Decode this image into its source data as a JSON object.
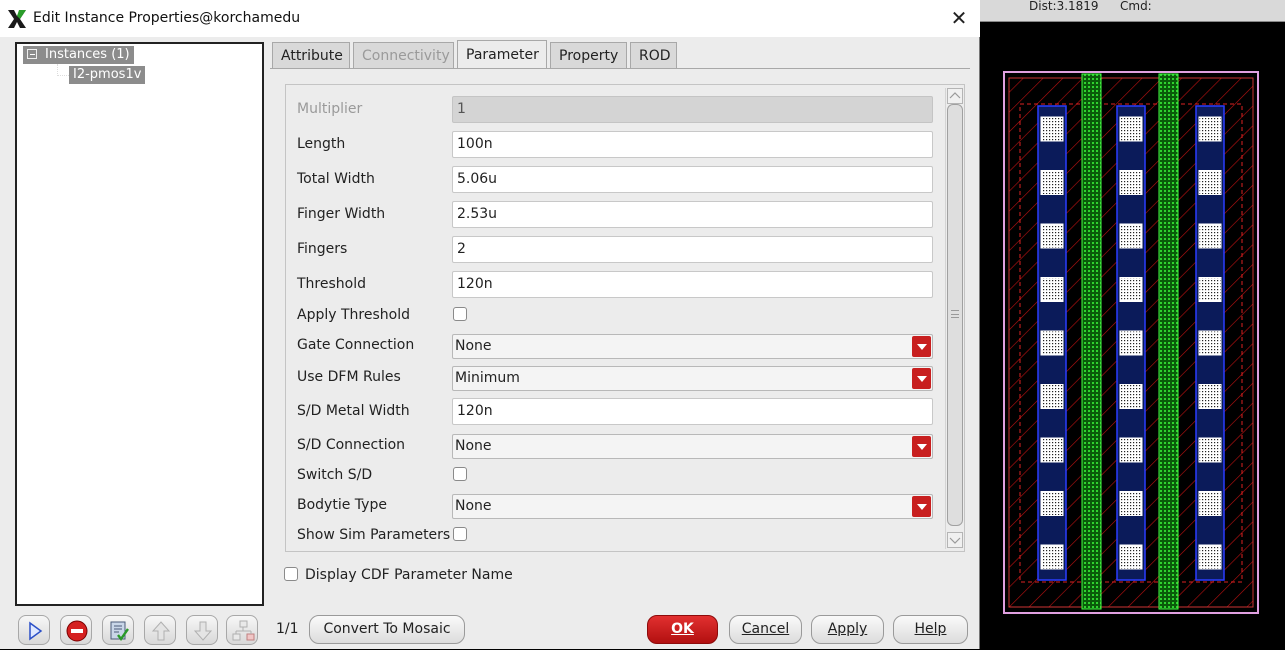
{
  "background": {
    "status_dist": "Dist:3.1819",
    "status_cmd": "Cmd:"
  },
  "dialog": {
    "title": "Edit Instance Properties@korchamedu",
    "close_icon": "close-icon",
    "tree": {
      "root_label": "Instances (1)",
      "child_label": "I2-pmos1v"
    },
    "tabs": [
      {
        "label": "Attribute",
        "state": "normal"
      },
      {
        "label": "Connectivity",
        "state": "disabled"
      },
      {
        "label": "Parameter",
        "state": "active"
      },
      {
        "label": "Property",
        "state": "normal"
      },
      {
        "label": "ROD",
        "state": "normal"
      }
    ],
    "params": {
      "multiplier": {
        "label": "Multiplier",
        "value": "1"
      },
      "length": {
        "label": "Length",
        "value": "100n"
      },
      "total_width": {
        "label": "Total Width",
        "value": "5.06u"
      },
      "finger_width": {
        "label": "Finger Width",
        "value": "2.53u"
      },
      "fingers": {
        "label": "Fingers",
        "value": "2"
      },
      "threshold": {
        "label": "Threshold",
        "value": "120n"
      },
      "apply_threshold": {
        "label": "Apply Threshold",
        "checked": false
      },
      "gate_connection": {
        "label": "Gate Connection",
        "value": "None"
      },
      "use_dfm_rules": {
        "label": "Use DFM Rules",
        "value": "Minimum"
      },
      "sd_metal_width": {
        "label": "S/D Metal Width",
        "value": "120n"
      },
      "sd_connection": {
        "label": "S/D Connection",
        "value": "None"
      },
      "switch_sd": {
        "label": "Switch S/D",
        "checked": false
      },
      "bodytie_type": {
        "label": "Bodytie Type",
        "value": "None"
      },
      "show_sim_params": {
        "label": "Show Sim Parameters",
        "checked": false
      }
    },
    "display_cdf": {
      "label": "Display CDF Parameter Name",
      "checked": false
    },
    "footer": {
      "page_count": "1/1",
      "convert_label": "Convert To Mosaic",
      "ok_label": "OK",
      "cancel_label": "Cancel",
      "apply_label": "Apply",
      "help_label": "Help"
    },
    "colors": {
      "accent_red": "#c81f1f",
      "selection_gray": "#8c8c8c"
    }
  }
}
